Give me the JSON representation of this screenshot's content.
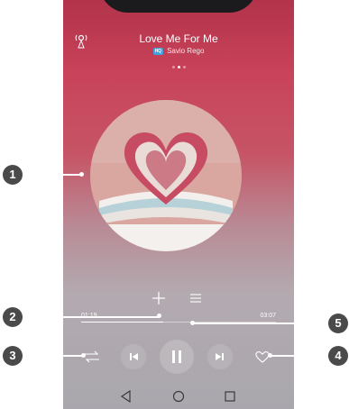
{
  "player": {
    "song_title": "Love Me For Me",
    "artist_badge": "HQ",
    "artist": "Savio Rego",
    "pager": {
      "count": 3,
      "active": 1
    },
    "progress": {
      "current": "01:19",
      "total": "03:07",
      "fraction": 0.42
    }
  },
  "callouts": [
    "1",
    "2",
    "3",
    "4",
    "5"
  ],
  "icons": {
    "cast": "cast-icon",
    "add": "plus-icon",
    "playlist": "menu-icon",
    "repeat": "repeat-icon",
    "previous": "previous-icon",
    "pause": "pause-icon",
    "next": "next-icon",
    "favorite": "heart-icon",
    "back": "back-icon",
    "home": "home-icon",
    "recent": "recent-apps-icon"
  },
  "colors": {
    "callout_badge": "#4a4a4a",
    "hq_badge": "#3fa3e0",
    "background_top": "#c9435a"
  }
}
